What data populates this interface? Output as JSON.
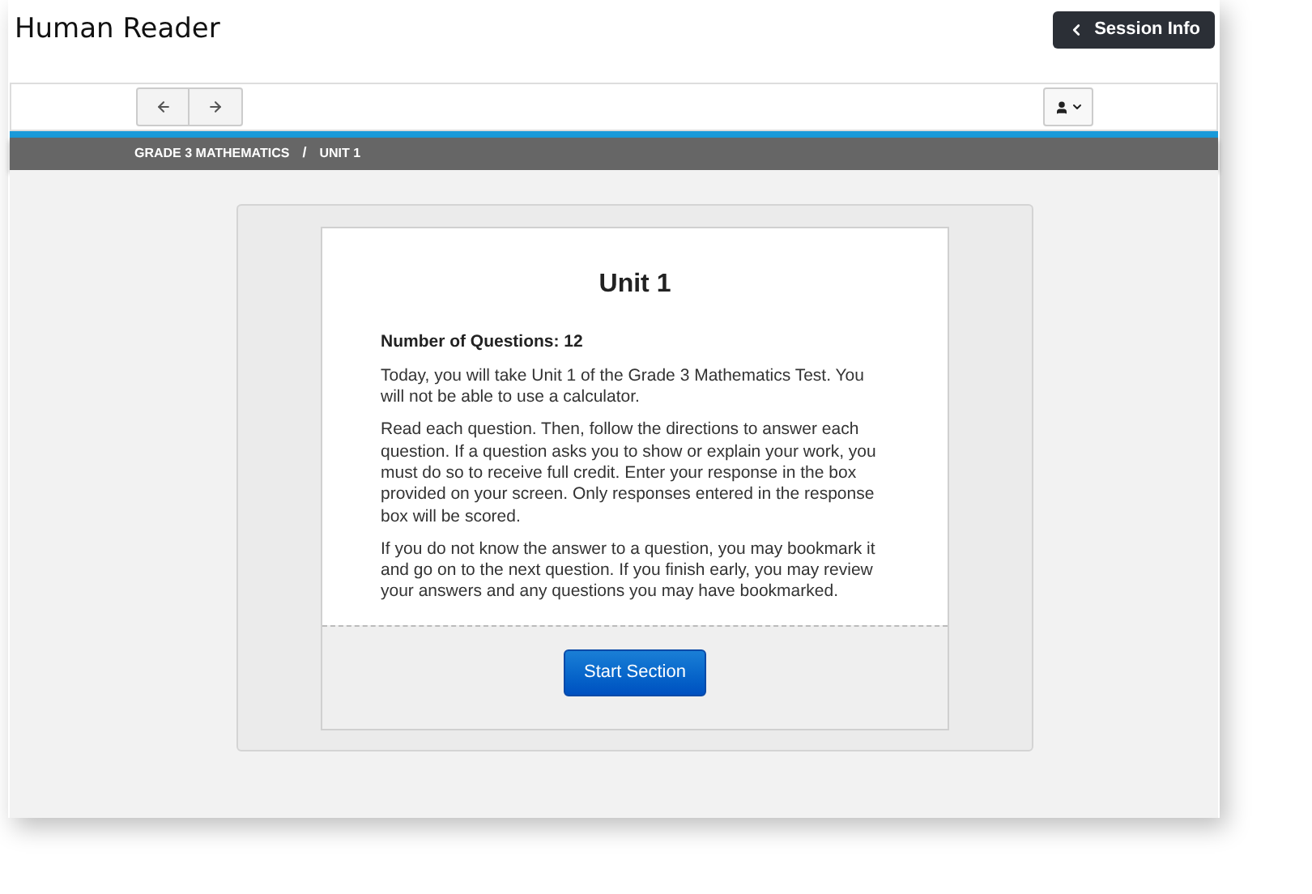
{
  "app_title": "Human Reader",
  "session_button": "Session Info",
  "breadcrumb": {
    "items": [
      "GRADE 3 MATHEMATICS",
      "UNIT 1"
    ],
    "separator": "/"
  },
  "section": {
    "title": "Unit 1",
    "count_label": "Number of Questions: 12",
    "paragraphs": [
      "Today, you will take Unit 1 of the Grade 3 Mathematics Test. You will not be able to use a calculator.",
      "Read each question. Then, follow the directions to answer each question. If a question asks you to show or explain your work, you must do so to receive full credit. Enter your response in the box provided on your screen. Only responses entered in the response box will be scored.",
      "If you do not know the answer to a question, you may bookmark it and go on to the next question. If you finish early, you may review your answers and any questions you may have bookmarked."
    ],
    "start_button": "Start Section"
  }
}
